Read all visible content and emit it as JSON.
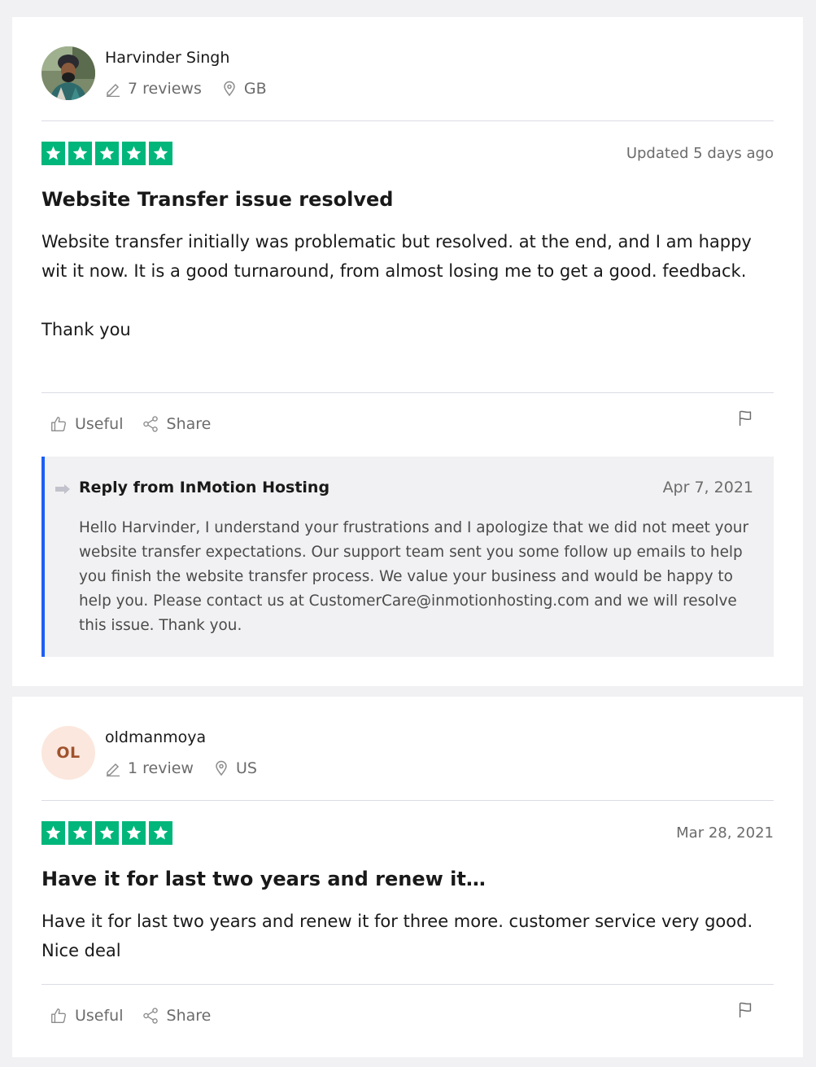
{
  "reviews": [
    {
      "consumer": {
        "name": "Harvinder Singh",
        "reviews": "7 reviews",
        "country": "GB",
        "avatar_type": "photo"
      },
      "rating": 5,
      "date": "Updated 5 days ago",
      "title": "Website Transfer issue resolved",
      "body": [
        "Website transfer initially was problematic but resolved. at the end, and I am happy wit it now. It is a good turnaround, from almost losing me to get a good. feedback.",
        "Thank you"
      ],
      "actions": {
        "useful": "Useful",
        "share": "Share"
      },
      "reply": {
        "from": "Reply from InMotion Hosting",
        "date": "Apr 7, 2021",
        "text": "Hello Harvinder, I understand your frustrations and I apologize that we did not meet your website transfer expectations. Our support team sent you some follow up emails to help you finish the website transfer process. We value your business and would be happy to help you. Please contact us at CustomerCare@inmotionhosting.com and we will resolve this issue. Thank you."
      }
    },
    {
      "consumer": {
        "name": "oldmanmoya",
        "reviews": "1 review",
        "country": "US",
        "initials": "OL"
      },
      "rating": 5,
      "date": "Mar 28, 2021",
      "title": "Have it for last two years and renew it…",
      "body": [
        "Have it for last two years and renew it for three more. customer service very good. Nice deal"
      ],
      "actions": {
        "useful": "Useful",
        "share": "Share"
      }
    }
  ],
  "colors": {
    "star_green": "#00b67a",
    "reply_border": "#1c5ff5",
    "page_bg": "#f1f1f3",
    "initials_bg": "#fbe7dd",
    "initials_text": "#a0522d"
  },
  "icons": [
    "pencil-icon",
    "location-pin-icon",
    "star-icon",
    "thumbs-up-icon",
    "share-icon",
    "flag-icon",
    "reply-arrow-icon"
  ]
}
